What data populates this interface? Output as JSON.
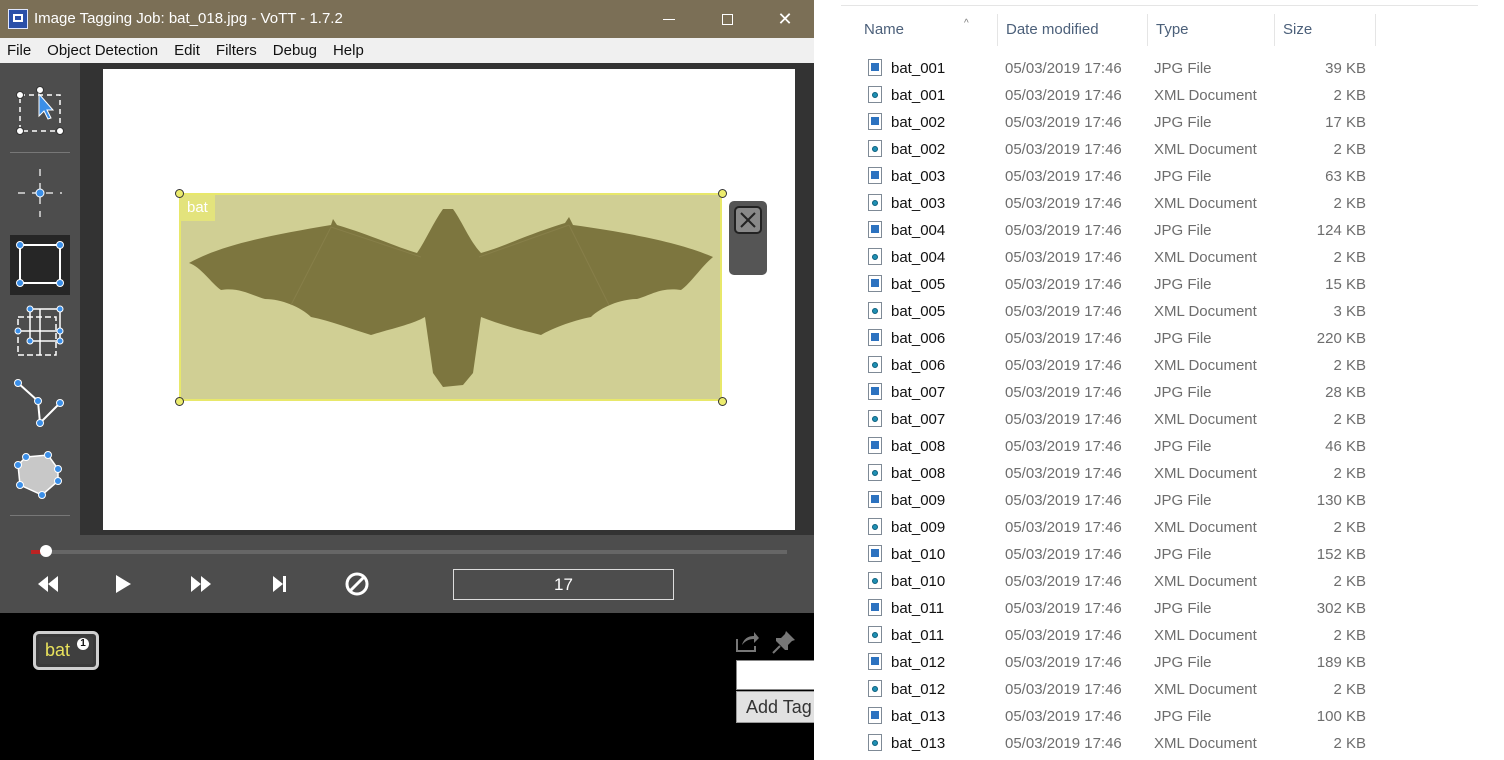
{
  "window": {
    "title": "Image Tagging Job: bat_018.jpg - VoTT - 1.7.2",
    "controls": [
      "minimize",
      "maximize",
      "close"
    ]
  },
  "menu": [
    "File",
    "Object Detection",
    "Edit",
    "Filters",
    "Debug",
    "Help"
  ],
  "toolbar": {
    "tools": [
      {
        "name": "select-tool",
        "icon": "select-cursor-icon",
        "active": false
      },
      {
        "name": "point-tool",
        "icon": "point-icon",
        "active": false
      },
      {
        "name": "rectangle-tool",
        "icon": "rectangle-icon",
        "active": true
      },
      {
        "name": "copy-rectangle-tool",
        "icon": "copy-rectangle-icon",
        "active": false
      },
      {
        "name": "polyline-tool",
        "icon": "polyline-icon",
        "active": false
      },
      {
        "name": "polygon-tool",
        "icon": "polygon-icon",
        "active": false
      }
    ]
  },
  "region": {
    "tag": "bat",
    "color": "#e8e86a"
  },
  "playback": {
    "progress": 0.02,
    "frame": "17",
    "buttons": [
      "previous",
      "play",
      "next",
      "skip-to-end",
      "clear"
    ]
  },
  "tags": {
    "items": [
      {
        "name": "bat",
        "hotkey": "1"
      }
    ],
    "add_button": "Add Tag"
  },
  "explorer": {
    "columns": {
      "name": "Name",
      "date": "Date modified",
      "type": "Type",
      "size": "Size"
    },
    "files": [
      {
        "name": "bat_001",
        "date": "05/03/2019 17:46",
        "type": "JPG File",
        "size": "39 KB"
      },
      {
        "name": "bat_001",
        "date": "05/03/2019 17:46",
        "type": "XML Document",
        "size": "2 KB"
      },
      {
        "name": "bat_002",
        "date": "05/03/2019 17:46",
        "type": "JPG File",
        "size": "17 KB"
      },
      {
        "name": "bat_002",
        "date": "05/03/2019 17:46",
        "type": "XML Document",
        "size": "2 KB"
      },
      {
        "name": "bat_003",
        "date": "05/03/2019 17:46",
        "type": "JPG File",
        "size": "63 KB"
      },
      {
        "name": "bat_003",
        "date": "05/03/2019 17:46",
        "type": "XML Document",
        "size": "2 KB"
      },
      {
        "name": "bat_004",
        "date": "05/03/2019 17:46",
        "type": "JPG File",
        "size": "124 KB"
      },
      {
        "name": "bat_004",
        "date": "05/03/2019 17:46",
        "type": "XML Document",
        "size": "2 KB"
      },
      {
        "name": "bat_005",
        "date": "05/03/2019 17:46",
        "type": "JPG File",
        "size": "15 KB"
      },
      {
        "name": "bat_005",
        "date": "05/03/2019 17:46",
        "type": "XML Document",
        "size": "3 KB"
      },
      {
        "name": "bat_006",
        "date": "05/03/2019 17:46",
        "type": "JPG File",
        "size": "220 KB"
      },
      {
        "name": "bat_006",
        "date": "05/03/2019 17:46",
        "type": "XML Document",
        "size": "2 KB"
      },
      {
        "name": "bat_007",
        "date": "05/03/2019 17:46",
        "type": "JPG File",
        "size": "28 KB"
      },
      {
        "name": "bat_007",
        "date": "05/03/2019 17:46",
        "type": "XML Document",
        "size": "2 KB"
      },
      {
        "name": "bat_008",
        "date": "05/03/2019 17:46",
        "type": "JPG File",
        "size": "46 KB"
      },
      {
        "name": "bat_008",
        "date": "05/03/2019 17:46",
        "type": "XML Document",
        "size": "2 KB"
      },
      {
        "name": "bat_009",
        "date": "05/03/2019 17:46",
        "type": "JPG File",
        "size": "130 KB"
      },
      {
        "name": "bat_009",
        "date": "05/03/2019 17:46",
        "type": "XML Document",
        "size": "2 KB"
      },
      {
        "name": "bat_010",
        "date": "05/03/2019 17:46",
        "type": "JPG File",
        "size": "152 KB"
      },
      {
        "name": "bat_010",
        "date": "05/03/2019 17:46",
        "type": "XML Document",
        "size": "2 KB"
      },
      {
        "name": "bat_011",
        "date": "05/03/2019 17:46",
        "type": "JPG File",
        "size": "302 KB"
      },
      {
        "name": "bat_011",
        "date": "05/03/2019 17:46",
        "type": "XML Document",
        "size": "2 KB"
      },
      {
        "name": "bat_012",
        "date": "05/03/2019 17:46",
        "type": "JPG File",
        "size": "189 KB"
      },
      {
        "name": "bat_012",
        "date": "05/03/2019 17:46",
        "type": "XML Document",
        "size": "2 KB"
      },
      {
        "name": "bat_013",
        "date": "05/03/2019 17:46",
        "type": "JPG File",
        "size": "100 KB"
      },
      {
        "name": "bat_013",
        "date": "05/03/2019 17:46",
        "type": "XML Document",
        "size": "2 KB"
      }
    ]
  }
}
